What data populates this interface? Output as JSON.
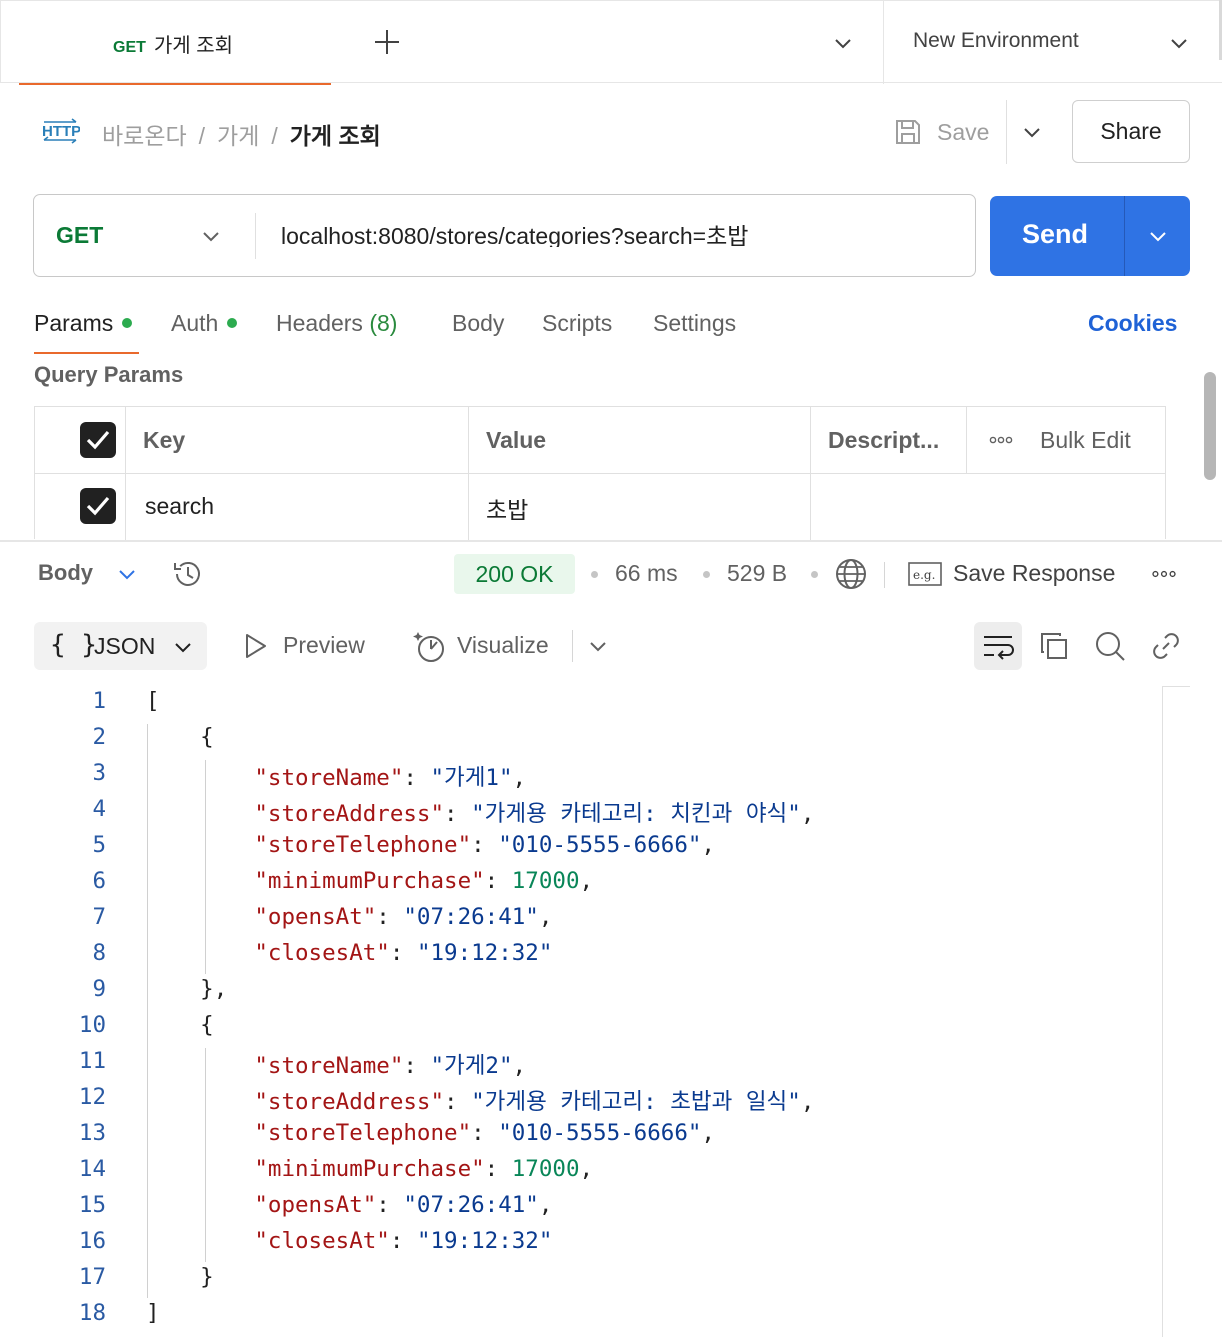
{
  "tabbar": {
    "active_tab": {
      "method": "GET",
      "title": "가게 조회"
    },
    "environment": "New Environment"
  },
  "breadcrumb": {
    "items": [
      "바로온다",
      "가게",
      "가게 조회"
    ],
    "save_label": "Save",
    "share_label": "Share"
  },
  "request": {
    "method": "GET",
    "url": "localhost:8080/stores/categories?search=초밥",
    "send_label": "Send"
  },
  "request_tabs": {
    "params": "Params",
    "auth": "Auth",
    "headers": "Headers",
    "headers_count": "(8)",
    "body": "Body",
    "scripts": "Scripts",
    "settings": "Settings",
    "cookies": "Cookies"
  },
  "query_params": {
    "title": "Query Params",
    "headers": {
      "key": "Key",
      "value": "Value",
      "description": "Descript...",
      "bulk_edit": "Bulk Edit"
    },
    "rows": [
      {
        "key": "search",
        "value": "초밥",
        "description": ""
      }
    ]
  },
  "response": {
    "body_label": "Body",
    "status": "200 OK",
    "time": "66 ms",
    "size": "529 B",
    "save_response": "Save Response",
    "format": "JSON",
    "format_brace": "{ }",
    "preview": "Preview",
    "visualize": "Visualize",
    "eg_label": "e.g."
  },
  "code_lines": [
    "1",
    "2",
    "3",
    "4",
    "5",
    "6",
    "7",
    "8",
    "9",
    "10",
    "11",
    "12",
    "13",
    "14",
    "15",
    "16",
    "17",
    "18"
  ],
  "json_body": {
    "stores": [
      {
        "storeName": "\"가게1\"",
        "storeAddress": "\"가게용 카테고리: 치킨과 야식\"",
        "storeTelephone": "\"010-5555-6666\"",
        "minimumPurchase": "17000",
        "opensAt": "\"07:26:41\"",
        "closesAt": "\"19:12:32\""
      },
      {
        "storeName": "\"가게2\"",
        "storeAddress": "\"가게용 카테고리: 초밥과 일식\"",
        "storeTelephone": "\"010-5555-6666\"",
        "minimumPurchase": "17000",
        "opensAt": "\"07:26:41\"",
        "closesAt": "\"19:12:32\""
      }
    ],
    "keys": {
      "storeName": "\"storeName\"",
      "storeAddress": "\"storeAddress\"",
      "storeTelephone": "\"storeTelephone\"",
      "minimumPurchase": "\"minimumPurchase\"",
      "opensAt": "\"opensAt\"",
      "closesAt": "\"closesAt\""
    }
  },
  "colors": {
    "accent": "#e9692c",
    "send": "#2f73e4",
    "get_method": "#0b7a36",
    "status_ok_bg": "#e9f7ec",
    "json_key": "#a31515",
    "json_string": "#0a3a8f",
    "json_number": "#098658"
  }
}
